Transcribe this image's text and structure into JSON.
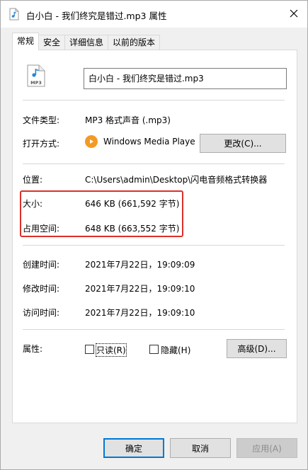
{
  "window": {
    "title": "白小白 - 我们终究是错过.mp3 属性",
    "close_glyph": "✕"
  },
  "tabs": [
    {
      "label": "常规",
      "active": true
    },
    {
      "label": "安全",
      "active": false
    },
    {
      "label": "详细信息",
      "active": false
    },
    {
      "label": "以前的版本",
      "active": false
    }
  ],
  "general": {
    "filename": "白小白 - 我们终究是错过.mp3",
    "file_icon_text": "MP3",
    "file_type_label": "文件类型:",
    "file_type_value": "MP3 格式声音 (.mp3)",
    "opens_with_label": "打开方式:",
    "opens_with_value": "Windows Media Playe",
    "change_button": "更改(C)...",
    "location_label": "位置:",
    "location_value": "C:\\Users\\admin\\Desktop\\闪电音频格式转换器",
    "size_label": "大小:",
    "size_value": "646 KB (661,592 字节)",
    "size_on_disk_label": "占用空间:",
    "size_on_disk_value": "648 KB (663,552 字节)",
    "created_label": "创建时间:",
    "created_value": "2021年7月22日，19:09:09",
    "modified_label": "修改时间:",
    "modified_value": "2021年7月22日，19:09:10",
    "accessed_label": "访问时间:",
    "accessed_value": "2021年7月22日，19:09:10",
    "attributes_label": "属性:",
    "readonly_label": "只读(R)",
    "readonly_checked": false,
    "hidden_label": "隐藏(H)",
    "hidden_checked": false,
    "advanced_button": "高级(D)..."
  },
  "footer": {
    "ok": "确定",
    "cancel": "取消",
    "apply": "应用(A)"
  },
  "colors": {
    "highlight_border": "#d9312b",
    "primary_border": "#0078d7",
    "app_icon": "#f29a26"
  }
}
